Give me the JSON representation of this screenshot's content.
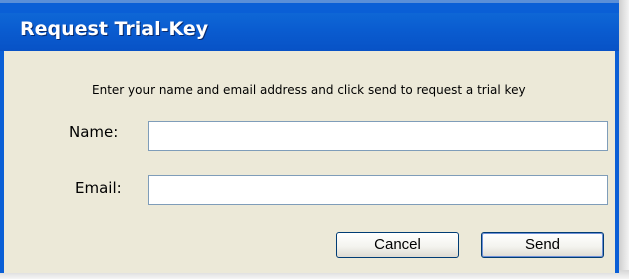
{
  "window": {
    "title": "Request Trial-Key"
  },
  "form": {
    "instruction": "Enter your name and email address and click send to request a trial key",
    "name_label": "Name:",
    "name_value": "",
    "email_label": "Email:",
    "email_value": ""
  },
  "buttons": {
    "cancel": "Cancel",
    "send": "Send"
  },
  "colors": {
    "titlebar": "#0a5fd6",
    "client": "#ece9d8",
    "textbox_border": "#7f9db9"
  }
}
